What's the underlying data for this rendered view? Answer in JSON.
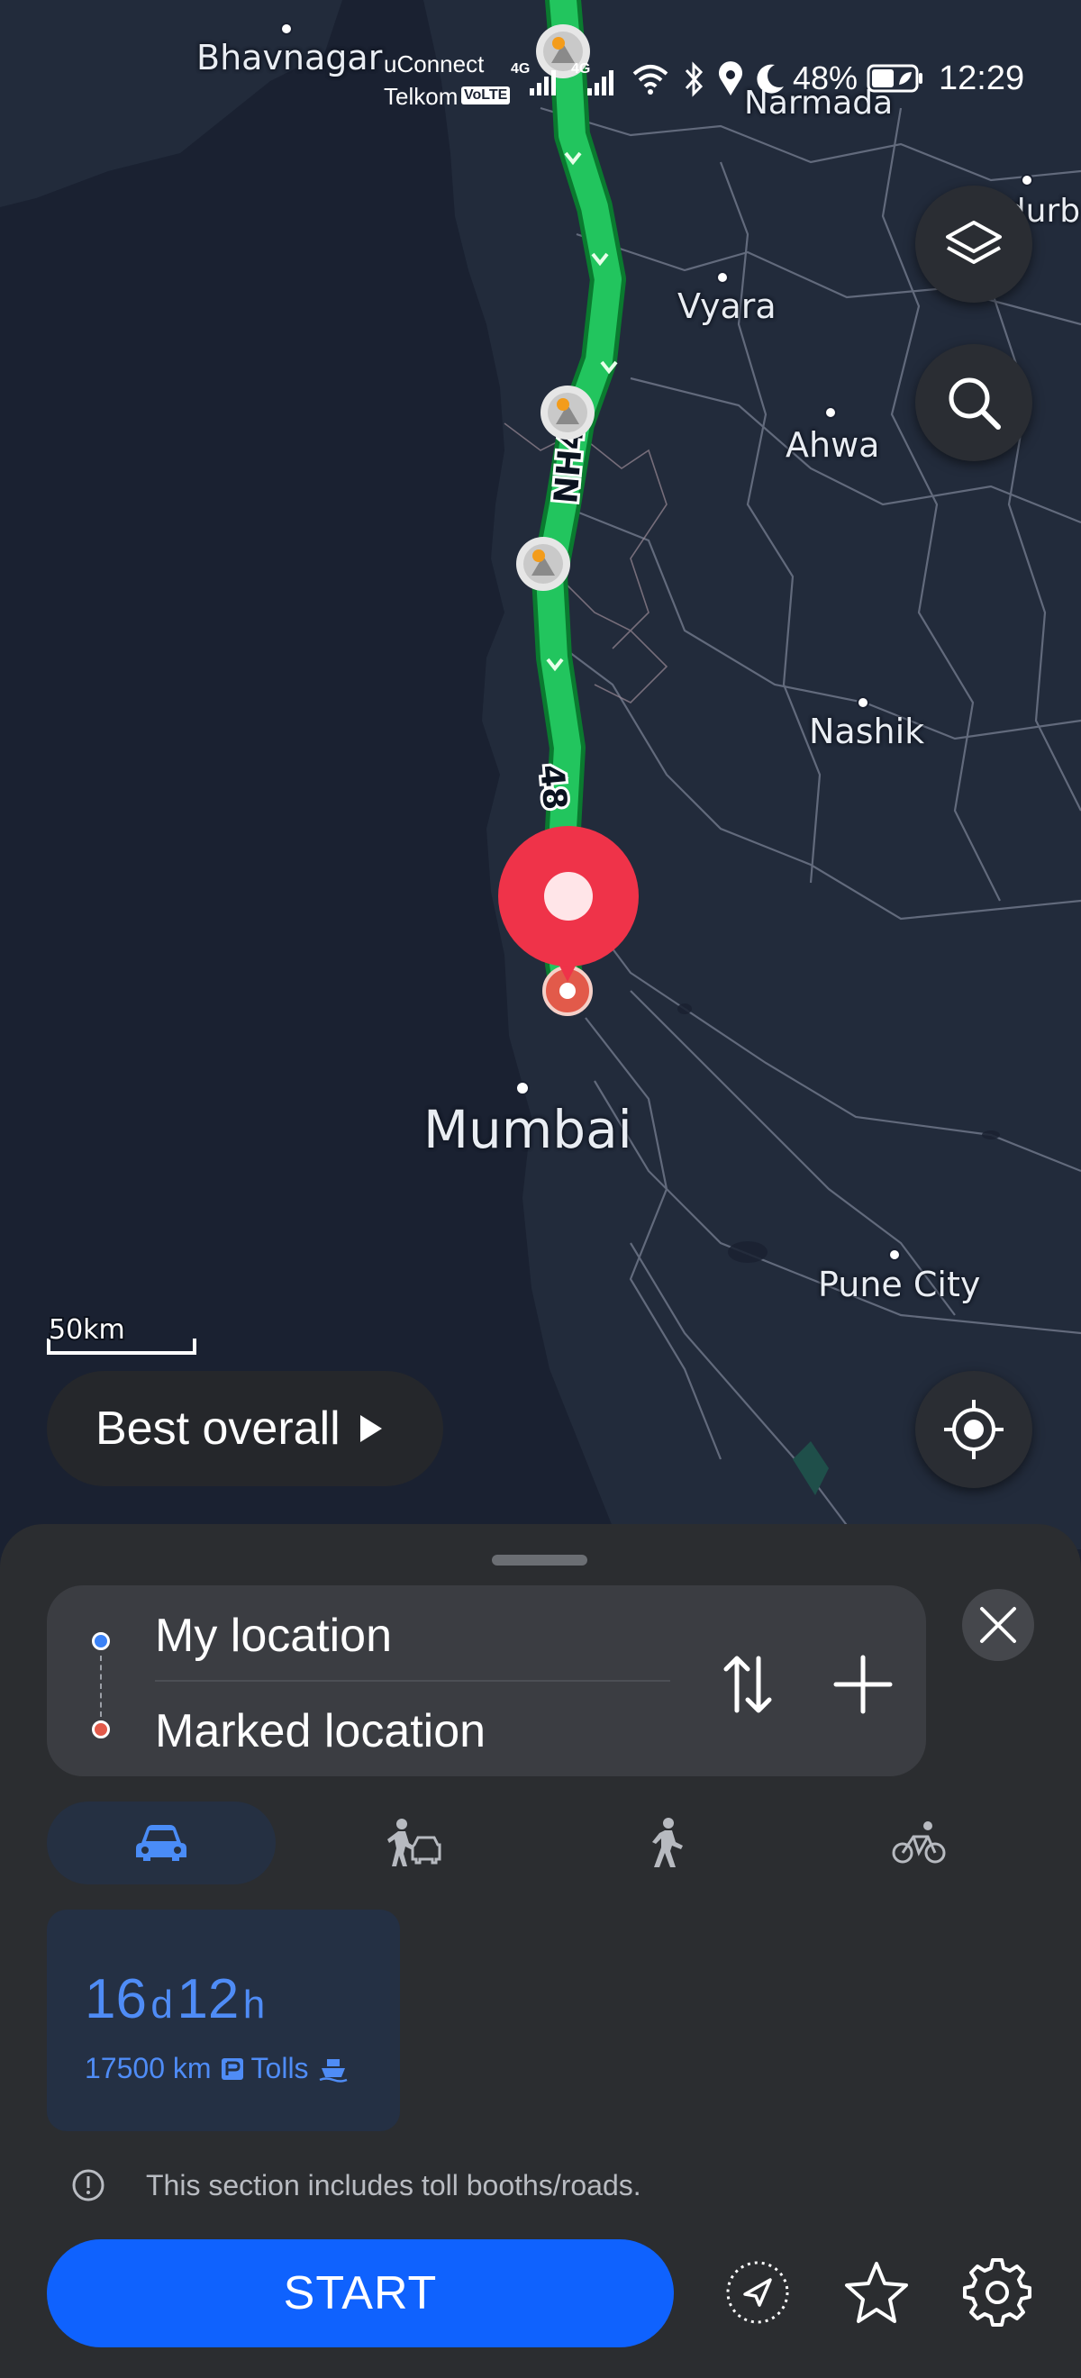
{
  "status_bar": {
    "carrier_line1": "uConnect",
    "carrier_line2": "Telkom",
    "volte": "VoLTE",
    "net1": "4G",
    "net2": "4G",
    "battery": "48%",
    "time": "12:29"
  },
  "map": {
    "cities": [
      {
        "name": "Bhavnagar"
      },
      {
        "name": "Narmada"
      },
      {
        "name": "Nandurb"
      },
      {
        "name": "Vyara"
      },
      {
        "name": "Ahwa"
      },
      {
        "name": "Nashik"
      },
      {
        "name": "Mumbai"
      },
      {
        "name": "Pune City"
      }
    ],
    "road_label_1": "NH48",
    "road_label_2": "48",
    "scale_label": "50km",
    "route_color": "#22c55e",
    "pin_color": "#ef3349"
  },
  "route_preference": {
    "label": "Best overall"
  },
  "panel": {
    "origin": "My location",
    "destination": "Marked location",
    "origin_dot_color": "#3b82f6",
    "destination_dot_color": "#e25a4a"
  },
  "modes": [
    {
      "name": "car-icon",
      "active": true
    },
    {
      "name": "ride-hailing-icon",
      "active": false
    },
    {
      "name": "walking-icon",
      "active": false
    },
    {
      "name": "cycling-icon",
      "active": false
    }
  ],
  "route_summary": {
    "days": "16",
    "days_unit": "d",
    "hours": "12",
    "hours_unit": "h",
    "distance": "17500 km",
    "tolls": "Tolls"
  },
  "notice": "This section includes toll booths/roads.",
  "start_label": "START",
  "accent_color": "#0f62fe"
}
